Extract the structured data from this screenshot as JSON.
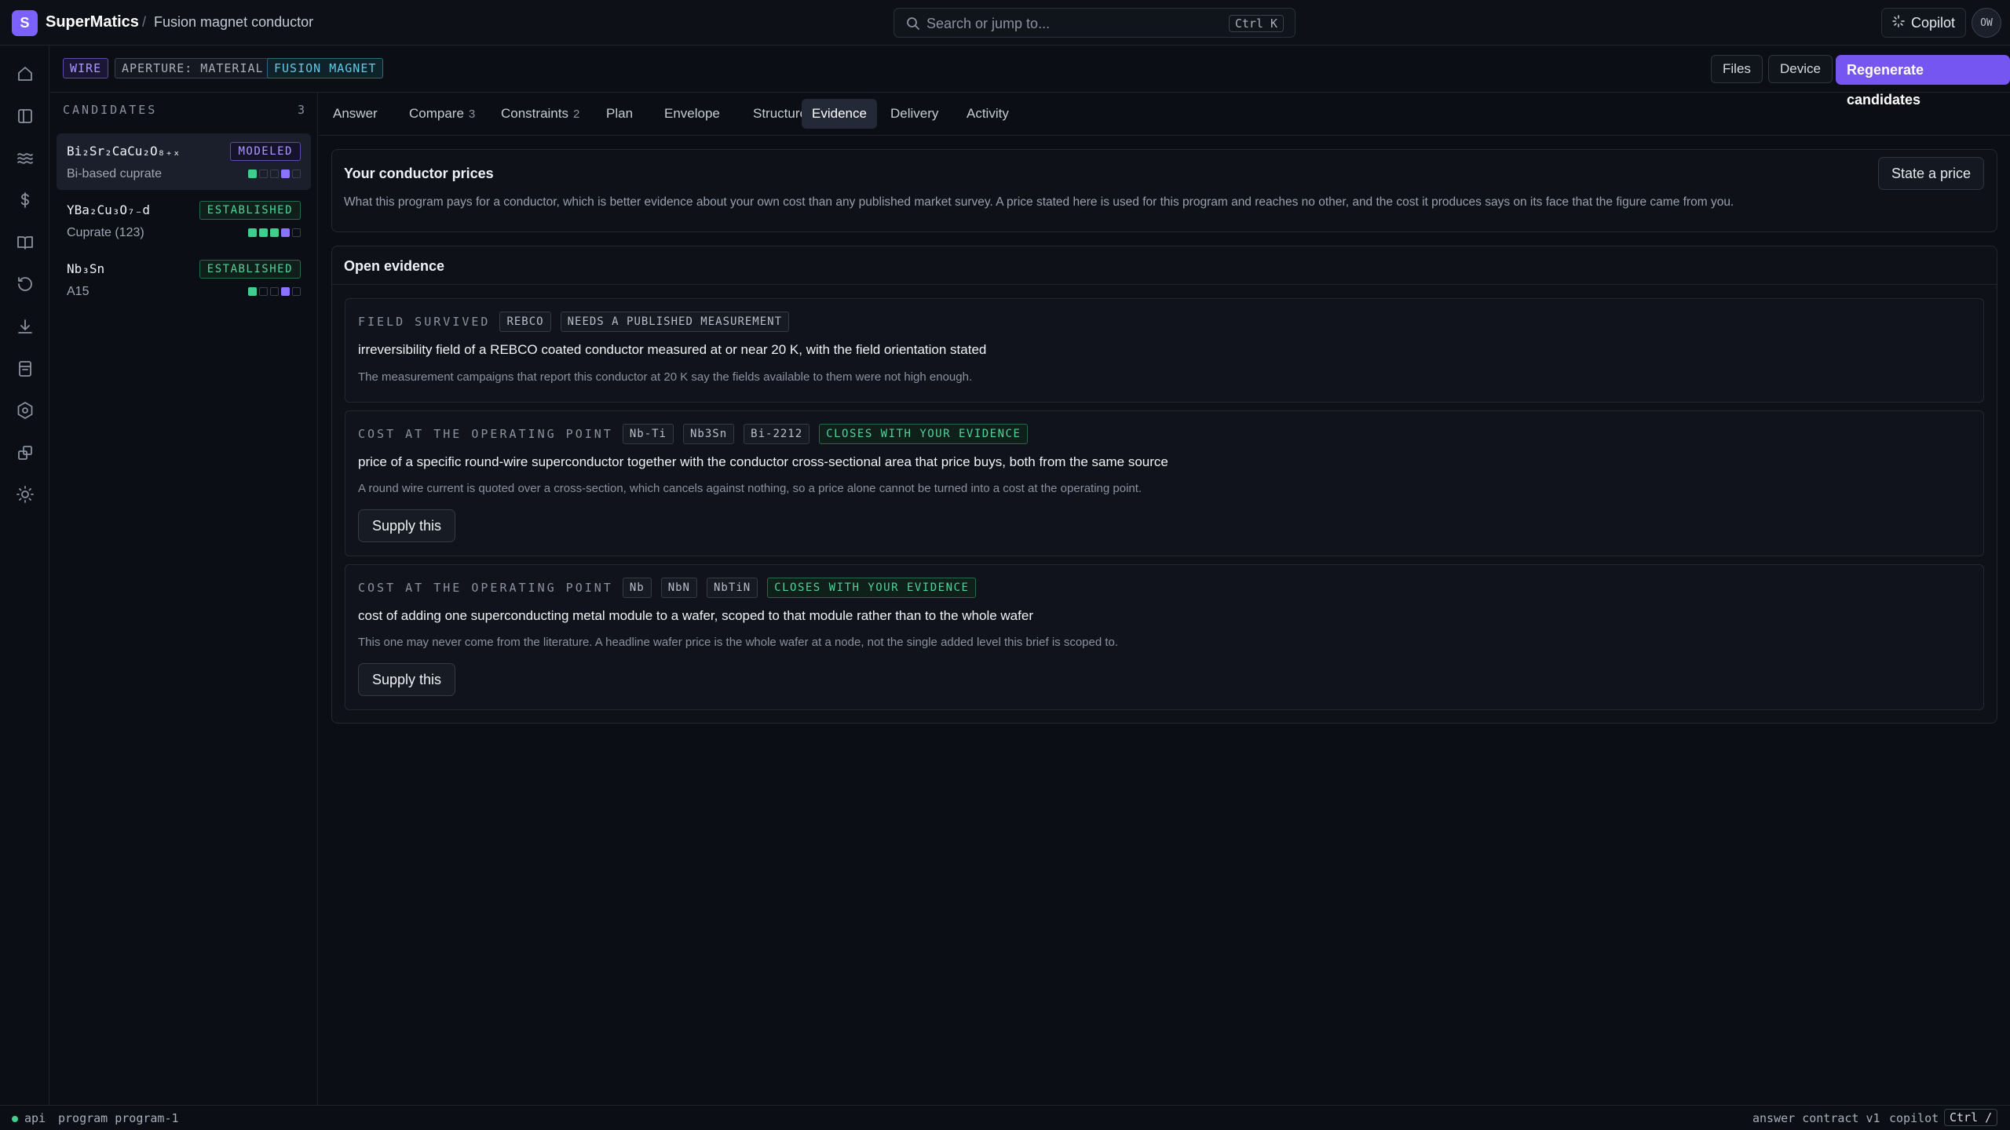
{
  "app": {
    "logo_letter": "S",
    "name": "SuperMatics",
    "breadcrumb_sep": "/",
    "breadcrumb": "Fusion magnet conductor"
  },
  "search": {
    "placeholder": "Search or jump to...",
    "shortcut": "Ctrl K",
    "icon": "search-icon"
  },
  "copilot": {
    "label": "Copilot",
    "icon": "sparkle-icon"
  },
  "user": {
    "initials": "OW"
  },
  "rail": [
    "home-icon",
    "sidebar-icon",
    "waves-icon",
    "dollar-icon",
    "book-icon",
    "history-icon",
    "download-icon",
    "archive-icon",
    "settings-icon",
    "extensions-icon",
    "sun-icon"
  ],
  "header": {
    "tags": [
      "WIRE",
      "APERTURE: MATERIAL",
      "FUSION MAGNET"
    ],
    "files_label": "Files",
    "device_label": "Device",
    "regenerate_label": "Regenerate candidates"
  },
  "candidates": {
    "header": "CANDIDATES",
    "count": "3",
    "items": [
      {
        "name": "Bi₂Sr₂CaCu₂O₈₊ₓ",
        "sub": "Bi-based cuprate",
        "badge": "MODELED",
        "squares": [
          "g",
          "e",
          "e",
          "p",
          "e"
        ]
      },
      {
        "name": "YBa₂Cu₃O₇₋d",
        "sub": "Cuprate (123)",
        "badge": "ESTABLISHED",
        "squares": [
          "g",
          "g",
          "g",
          "p",
          "e"
        ]
      },
      {
        "name": "Nb₃Sn",
        "sub": "A15",
        "badge": "ESTABLISHED",
        "squares": [
          "g",
          "e",
          "e",
          "p",
          "e"
        ]
      }
    ]
  },
  "tabs": [
    {
      "label": "Answer",
      "count": ""
    },
    {
      "label": "Compare",
      "count": "3"
    },
    {
      "label": "Constraints",
      "count": "2"
    },
    {
      "label": "Plan",
      "count": ""
    },
    {
      "label": "Envelope",
      "count": ""
    },
    {
      "label": "Structure",
      "count": ""
    },
    {
      "label": "Evidence",
      "count": "",
      "active": true
    },
    {
      "label": "Delivery",
      "count": ""
    },
    {
      "label": "Activity",
      "count": ""
    }
  ],
  "prices": {
    "title": "Your conductor prices",
    "button": "State a price",
    "description": "What this program pays for a conductor, which is better evidence about your own cost than any published market survey. A price stated here is used for this program and reaches no other, and the cost it produces says on its face that the figure came from you."
  },
  "open_evidence": {
    "title": "Open evidence",
    "items": [
      {
        "kind": "FIELD SURVIVED",
        "chips": [
          "REBCO"
        ],
        "status": "NEEDS A PUBLISHED MEASUREMENT",
        "title": "irreversibility field of a REBCO coated conductor measured at or near 20 K, with the field orientation stated",
        "note": "The measurement campaigns that report this conductor at 20 K say the fields available to them were not high enough."
      },
      {
        "kind": "COST AT THE OPERATING POINT",
        "chips": [
          "Nb-Ti",
          "Nb3Sn",
          "Bi-2212"
        ],
        "status": "CLOSES WITH YOUR EVIDENCE",
        "title": "price of a specific round-wire superconductor together with the conductor cross-sectional area that price buys, both from the same source",
        "note": "A round wire current is quoted over a cross-section, which cancels against nothing, so a price alone cannot be turned into a cost at the operating point.",
        "button": "Supply this"
      },
      {
        "kind": "COST AT THE OPERATING POINT",
        "chips": [
          "Nb",
          "NbN",
          "NbTiN"
        ],
        "status": "CLOSES WITH YOUR EVIDENCE",
        "title": "cost of adding one superconducting metal module to a wafer, scoped to that module rather than to the whole wafer",
        "note": "This one may never come from the literature. A headline wafer price is the whole wafer at a node, not the single added level this brief is scoped to.",
        "button": "Supply this"
      }
    ]
  },
  "status": {
    "api": "api",
    "program": "program program-1",
    "contract": "answer contract v1",
    "copilot": "copilot",
    "shortcut": "Ctrl /"
  }
}
